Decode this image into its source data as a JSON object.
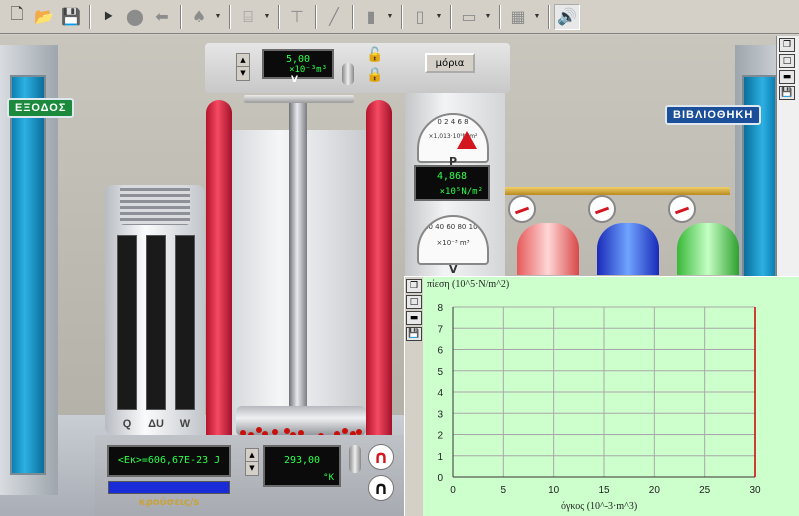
{
  "toolbar": {
    "buttons": [
      {
        "name": "new-icon",
        "glyph": "🗋"
      },
      {
        "name": "open-folder-icon",
        "glyph": "📂"
      },
      {
        "name": "save-icon",
        "glyph": "💾"
      },
      {
        "name": "play-icon",
        "glyph": "⯈"
      },
      {
        "name": "stop-icon",
        "glyph": "⬤"
      },
      {
        "name": "back-arrow-icon",
        "glyph": "⬅"
      },
      {
        "name": "drop-icon",
        "glyph": "♠"
      },
      {
        "name": "cylinder-icon",
        "glyph": "⌸"
      },
      {
        "name": "piston-icon",
        "glyph": "⊤"
      },
      {
        "name": "rod-icon",
        "glyph": "╱"
      },
      {
        "name": "bottle-icon",
        "glyph": "▮"
      },
      {
        "name": "flask-icon",
        "glyph": "▯"
      },
      {
        "name": "plate-icon",
        "glyph": "▭"
      },
      {
        "name": "texture-icon",
        "glyph": "▦"
      },
      {
        "name": "speaker-icon",
        "glyph": "🔊"
      }
    ]
  },
  "signs": {
    "exit": "ΕΞΟΔΟΣ",
    "library": "ΒΙΒΛΙΟΘΗΚΗ"
  },
  "controls": {
    "limits_button": "μόρια"
  },
  "volume_display": {
    "value": "5,00",
    "unit": "×10⁻³m³",
    "letter": "V"
  },
  "pressure_gauge": {
    "scale_text": "×1,013·10⁵N/m²",
    "ticks": [
      "0",
      "2",
      "4",
      "6",
      "8"
    ],
    "letter": "P"
  },
  "pressure_display": {
    "value": "4,868",
    "unit": "×10⁵N/m²"
  },
  "volume_gauge": {
    "scale_text": "×10⁻³ m³",
    "ticks": [
      "20",
      "40",
      "60",
      "80",
      "100"
    ],
    "letter": "V"
  },
  "kinetic_display": {
    "value": "<Eκ>=606,67E-23 J"
  },
  "collision_label": "κρούσεις/s",
  "temperature_display": {
    "value": "293,00",
    "unit": "°K"
  },
  "energy_bars": {
    "labels": [
      "Q",
      "ΔU",
      "W"
    ]
  },
  "chart_data": {
    "type": "line",
    "ylabel": "πίεση (10^5·N/m^2)",
    "xlabel": "όγκος (10^-3·m^3)",
    "xlim": [
      0,
      30
    ],
    "ylim": [
      0,
      8
    ],
    "xticks": [
      0,
      5,
      10,
      15,
      20,
      25,
      30
    ],
    "yticks": [
      0,
      1,
      2,
      3,
      4,
      5,
      6,
      7,
      8
    ],
    "grid": true,
    "series": [],
    "vertical_marker_x": 30,
    "colors": {
      "background": "#ccffcc",
      "grid": "#a8a8a8",
      "marker": "#cc0000"
    }
  }
}
